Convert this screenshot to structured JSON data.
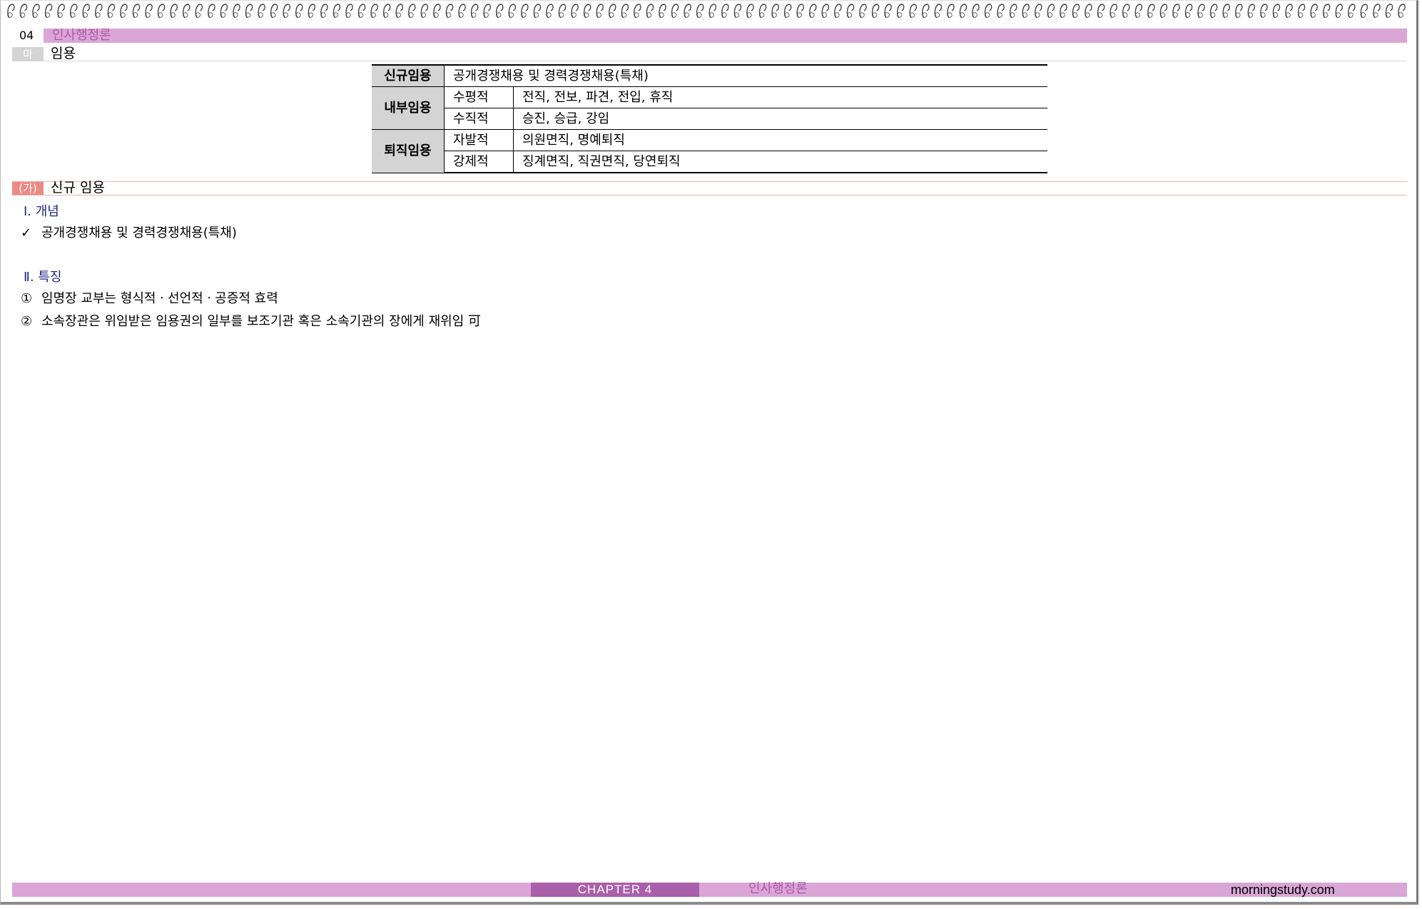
{
  "chapter": {
    "number": "04",
    "title": "인사행정론"
  },
  "section": {
    "badge": "마",
    "title": "임용"
  },
  "summary_table": {
    "rows": [
      {
        "head": "신규임용",
        "content": "공개경쟁채용 및 경력경쟁채용(특채)"
      },
      {
        "head": "내부임용",
        "items": [
          {
            "type": "수평적",
            "content": "전직, 전보, 파견, 전입, 휴직"
          },
          {
            "type": "수직적",
            "content": "승진, 승급, 강임"
          }
        ]
      },
      {
        "head": "퇴직임용",
        "items": [
          {
            "type": "자발적",
            "content": "의원면직, 명예퇴직"
          },
          {
            "type": "강제적",
            "content": "징계면직, 직권면직, 당연퇴직"
          }
        ]
      }
    ]
  },
  "subsection": {
    "badge": "(가)",
    "title": "신규 임용"
  },
  "concept": {
    "heading": "Ⅰ. 개념",
    "items": [
      {
        "mark": "✓",
        "text": "공개경쟁채용 및 경력경쟁채용(특채)"
      }
    ]
  },
  "features": {
    "heading": "Ⅱ. 특징",
    "items": [
      {
        "mark": "①",
        "text": "임명장 교부는 형식적ㆍ선언적ㆍ공증적 효력"
      },
      {
        "mark": "②",
        "text": "소속장관은 위임받은 임용권의 일부를 보조기관 혹은 소속기관의 장에게 재위임 可"
      }
    ]
  },
  "footer": {
    "chapter_label": "CHAPTER 4",
    "title": "인사행정론",
    "site": "morningstudy.com"
  },
  "colors": {
    "accent_purple": "#d9a6d6",
    "dark_purple": "#a95fa9",
    "title_purple": "#b057ac",
    "salmon": "#ec8a86",
    "heading_navy": "#1e2680"
  }
}
